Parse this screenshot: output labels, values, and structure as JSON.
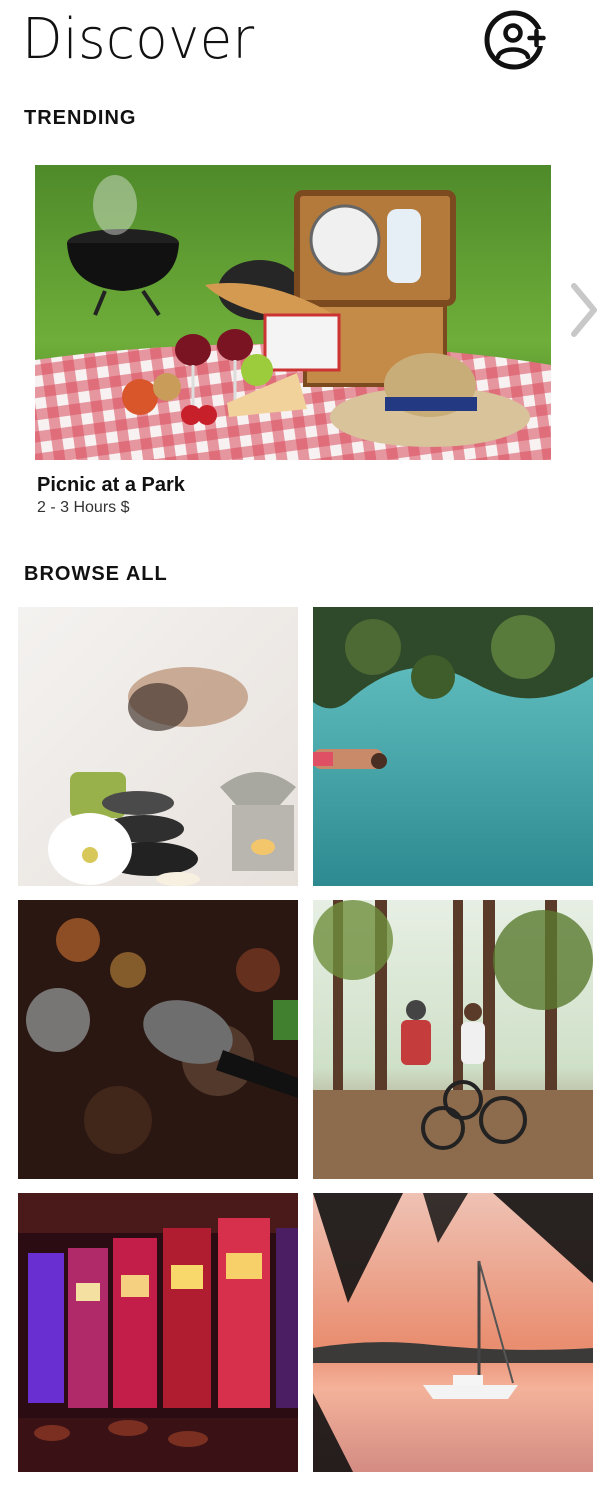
{
  "header": {
    "title": "Discover",
    "add_friend_icon": "add-user-icon"
  },
  "trending": {
    "section_label": "TRENDING",
    "card": {
      "title": "Picnic at a Park",
      "meta": "2 - 3 Hours $",
      "image": "picnic-photo"
    },
    "next_icon": "chevron-right-icon"
  },
  "browse": {
    "section_label": "BROWSE ALL",
    "tiles": [
      {
        "image": "spa-massage-photo"
      },
      {
        "image": "swimming-lake-photo"
      },
      {
        "image": "karaoke-microphone-photo"
      },
      {
        "image": "cycling-forest-photo"
      },
      {
        "image": "casino-slot-machines-photo"
      },
      {
        "image": "sailboat-sunset-photo"
      }
    ]
  },
  "colors": {
    "text": "#111111",
    "meta": "#333333",
    "chevron": "#c8c8c8"
  }
}
